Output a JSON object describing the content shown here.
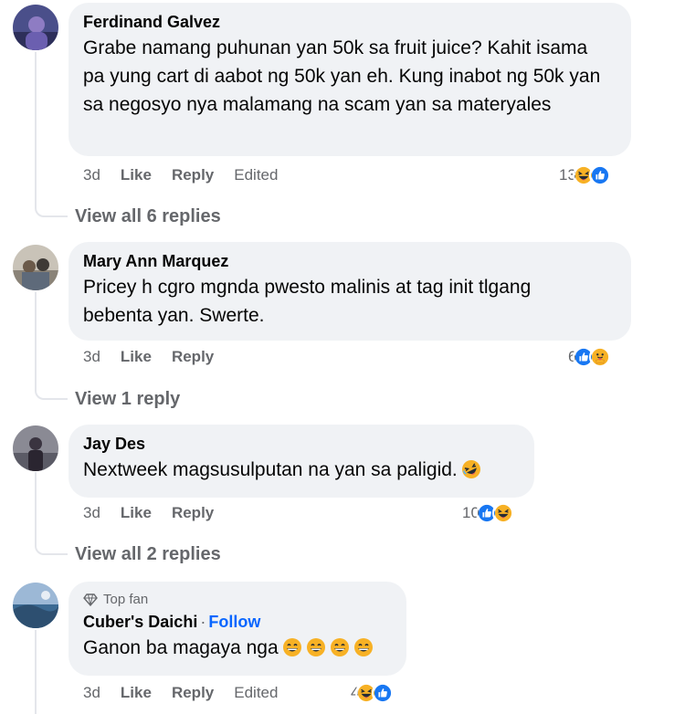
{
  "comments": [
    {
      "author": "Ferdinand Galvez",
      "text": "Grabe namang puhunan yan 50k sa fruit juice? Kahit isama pa yung cart di aabot ng 50k yan eh. Kung inabot ng 50k yan sa negosyo nya malamang na scam yan sa materyales",
      "time": "3d",
      "like_label": "Like",
      "reply_label": "Reply",
      "edited_label": "Edited",
      "reaction_count": "13",
      "reactions": [
        "haha-icon",
        "like-icon"
      ],
      "view_replies": "View all 6 replies"
    },
    {
      "author": "Mary Ann Marquez",
      "text": "Pricey h cgro mgnda pwesto malinis at tag init tlgang bebenta yan. Swerte.",
      "time": "3d",
      "like_label": "Like",
      "reply_label": "Reply",
      "reaction_count": "6",
      "reactions": [
        "like-icon",
        "care-icon"
      ],
      "view_replies": "View 1 reply"
    },
    {
      "author": "Jay Des",
      "text": "Nextweek magsusulputan na yan sa paligid.",
      "text_emoji": "rofl-emoji",
      "time": "3d",
      "like_label": "Like",
      "reply_label": "Reply",
      "reaction_count": "10",
      "reactions": [
        "like-icon",
        "haha-icon"
      ],
      "view_replies": "View all 2 replies"
    },
    {
      "badge": "Top fan",
      "author": "Cuber's Daichi",
      "separator": "·",
      "follow_label": "Follow",
      "text": "Ganon ba magaya nga",
      "text_emojis": [
        "grin-emoji",
        "grin-emoji",
        "grin-emoji",
        "grin-emoji"
      ],
      "time": "3d",
      "like_label": "Like",
      "reply_label": "Reply",
      "edited_label": "Edited",
      "reaction_count": "4",
      "reactions": [
        "haha-icon",
        "like-icon"
      ]
    }
  ],
  "colors": {
    "bubble": "#f0f2f5",
    "meta": "#65676b",
    "link": "#0866ff",
    "like_blue": "#1877f2"
  }
}
